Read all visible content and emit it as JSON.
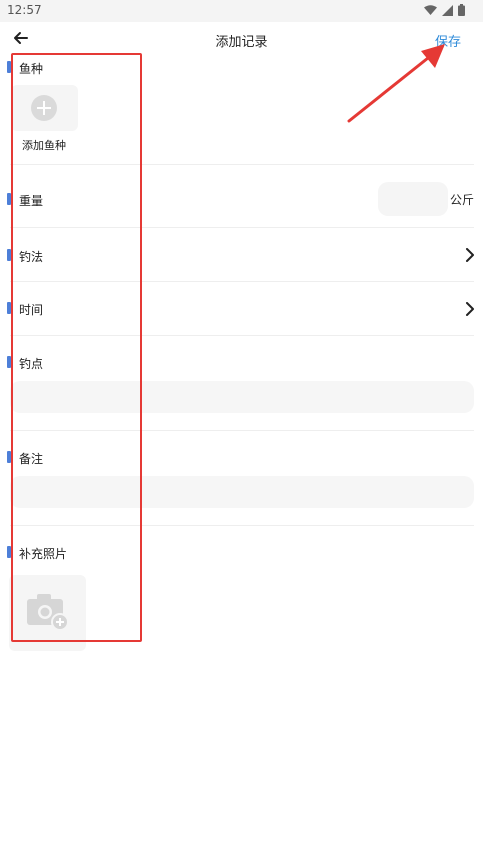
{
  "status_bar": {
    "time": "12:57"
  },
  "header": {
    "title": "添加记录",
    "save_label": "保存"
  },
  "form": {
    "species": {
      "label": "鱼种",
      "add_label": "添加鱼种"
    },
    "weight": {
      "label": "重量",
      "unit": "公斤",
      "value": ""
    },
    "method": {
      "label": "钓法"
    },
    "time": {
      "label": "时间"
    },
    "spot": {
      "label": "钓点",
      "value": ""
    },
    "note": {
      "label": "备注",
      "value": ""
    },
    "photo": {
      "label": "补充照片"
    }
  },
  "colors": {
    "accent": "#2f8bd9",
    "marker": "#4d7fd8",
    "annotation": "#e53935"
  }
}
